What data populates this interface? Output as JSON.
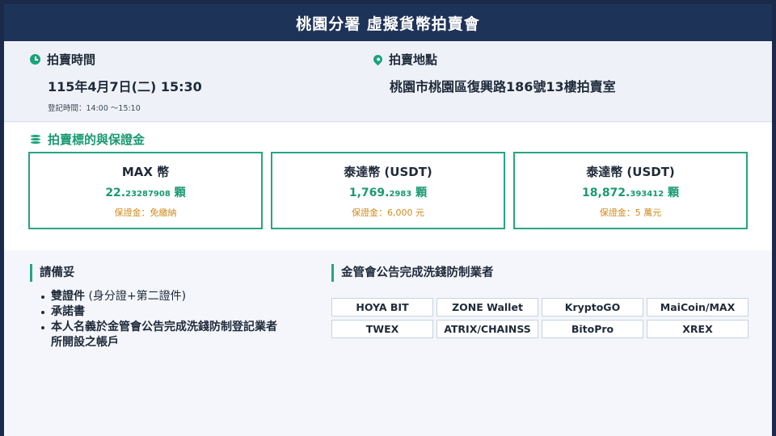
{
  "header": {
    "title": "桃園分署 虛擬貨幣拍賣會"
  },
  "auction_time": {
    "label": "拍賣時間",
    "value": "115年4月7日(二) 15:30",
    "registration": "登記時間：14:00 ～15:10"
  },
  "auction_location": {
    "label": "拍賣地點",
    "value": "桃園市桃園區復興路186號13樓拍賣室"
  },
  "items": {
    "title": "拍賣標的與保證金",
    "cards": [
      {
        "name": "MAX 幣",
        "amount_int": "22.",
        "amount_dec": "23287908",
        "unit": " 顆",
        "deposit": "保證金：免繳納"
      },
      {
        "name": "泰達幣 (USDT)",
        "amount_int": "1,769.",
        "amount_dec": "2983",
        "unit": " 顆",
        "deposit": "保證金：6,000 元"
      },
      {
        "name": "泰達幣 (USDT)",
        "amount_int": "18,872.",
        "amount_dec": "393412",
        "unit": " 顆",
        "deposit": "保證金：5 萬元"
      }
    ]
  },
  "prepare": {
    "title": "請備妥",
    "items": [
      {
        "main": "雙證件",
        "note": " (身分證+第二證件)"
      },
      {
        "main": "承諾書",
        "note": ""
      },
      {
        "main": "本人名義於金管會公告完成洗錢防制登記業者",
        "note": ""
      },
      {
        "main": "所開設之帳戶",
        "note": ""
      }
    ]
  },
  "vendors": {
    "title": "金管會公告完成洗錢防制業者",
    "list": [
      "HOYA BIT",
      "ZONE Wallet",
      "KryptoGO",
      "MaiCoin/MAX",
      "TWEX",
      "ATRIX/CHAINSS",
      "BitoPro",
      "XREX"
    ]
  }
}
